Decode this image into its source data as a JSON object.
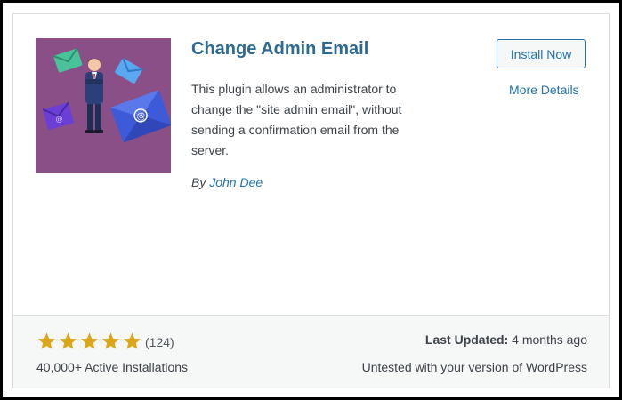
{
  "plugin": {
    "title": "Change Admin Email",
    "description": "This plugin allows an administrator to change the \"site admin email\", without sending a confirmation email from the server.",
    "author_prefix": "By",
    "author_name": "John Dee",
    "thumbnail_icon": "email-admin-illustration-icon"
  },
  "actions": {
    "install_label": "Install Now",
    "more_details_label": "More Details"
  },
  "footer": {
    "rating": 5,
    "rating_max": 5,
    "rating_count": "(124)",
    "active_installs": "40,000+ Active Installations",
    "last_updated_label": "Last Updated:",
    "last_updated_value": "4 months ago",
    "compatibility": "Untested with your version of WordPress"
  },
  "colors": {
    "link": "#2271b1",
    "title": "#2c6a91",
    "star": "#dba617",
    "thumbnail_bg": "#8a4f86",
    "footer_bg": "#f6f7f7"
  }
}
